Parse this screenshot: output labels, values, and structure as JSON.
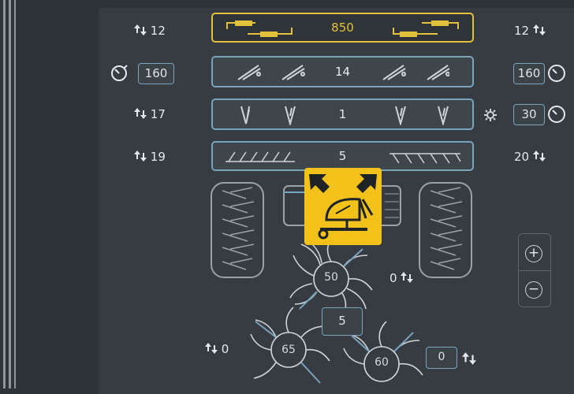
{
  "rows": {
    "drawbar": {
      "left_value": "12",
      "center_value": "850",
      "right_value": "12"
    },
    "pressure": {
      "left_value": "160",
      "center_value": "14",
      "right_value": "160"
    },
    "tines": {
      "left_value": "17",
      "center_value": "1",
      "right_value": "30"
    },
    "rollers": {
      "left_value": "19",
      "center_value": "5",
      "right_value": "20"
    }
  },
  "rotors": {
    "center": {
      "value": "50",
      "right_readout": "0"
    },
    "left": {
      "value": "65",
      "left_readout": "0"
    },
    "right": {
      "value": "60",
      "right_box": "0"
    },
    "middle_box": "5"
  },
  "zoom": {
    "plus": "+",
    "minus": "−"
  },
  "colors": {
    "accent": "#e2c23a",
    "outline": "#7aa3bd",
    "warning": "#f2c21a",
    "background": "#2d3338"
  },
  "icons": [
    "up-down-arrows-icon",
    "gauge-icon",
    "settings-gear-icon",
    "rake-warning-icon",
    "zoom-in-icon",
    "zoom-out-icon"
  ]
}
